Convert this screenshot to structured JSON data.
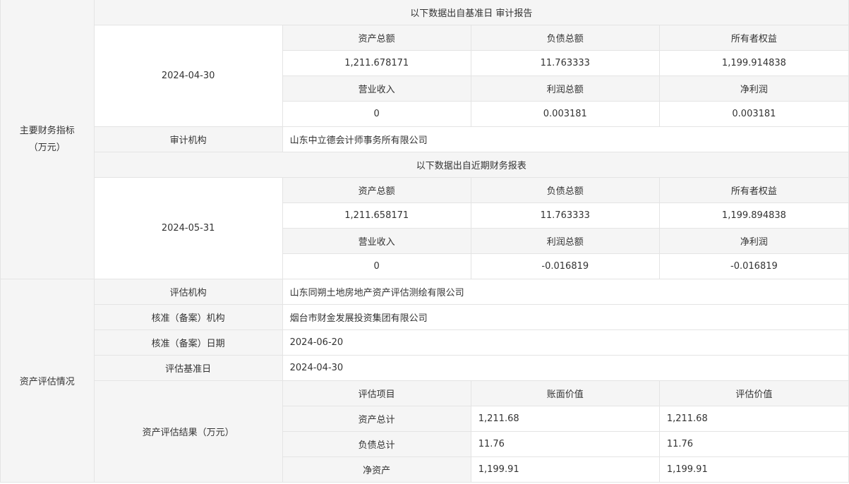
{
  "sections": {
    "financial": {
      "title_line1": "主要财务指标",
      "title_line2": "（万元）",
      "audit": {
        "source_note": "以下数据出自基准日 审计报告",
        "date": "2024-04-30",
        "headers1": [
          "资产总额",
          "负债总额",
          "所有者权益"
        ],
        "values1": [
          "1,211.678171",
          "11.763333",
          "1,199.914838"
        ],
        "headers2": [
          "营业收入",
          "利润总额",
          "净利润"
        ],
        "values2": [
          "0",
          "0.003181",
          "0.003181"
        ],
        "auditor_label": "审计机构",
        "auditor_value": "山东中立德会计师事务所有限公司"
      },
      "recent": {
        "source_note": "以下数据出自近期财务报表",
        "date": "2024-05-31",
        "headers1": [
          "资产总额",
          "负债总额",
          "所有者权益"
        ],
        "values1": [
          "1,211.658171",
          "11.763333",
          "1,199.894838"
        ],
        "headers2": [
          "营业收入",
          "利润总额",
          "净利润"
        ],
        "values2": [
          "0",
          "-0.016819",
          "-0.016819"
        ]
      }
    },
    "valuation": {
      "title": "资产评估情况",
      "rows": [
        {
          "label": "评估机构",
          "value": "山东同朔土地房地产资产评估测绘有限公司"
        },
        {
          "label": "核准（备案）机构",
          "value": "烟台市财金发展投资集团有限公司"
        },
        {
          "label": "核准（备案）日期",
          "value": "2024-06-20"
        },
        {
          "label": "评估基准日",
          "value": "2024-04-30"
        }
      ],
      "result": {
        "label": "资产评估结果（万元）",
        "headers": [
          "评估项目",
          "账面价值",
          "评估价值"
        ],
        "items": [
          {
            "name": "资产总计",
            "book": "1,211.68",
            "assessed": "1,211.68"
          },
          {
            "name": "负债总计",
            "book": "11.76",
            "assessed": "11.76"
          },
          {
            "name": "净资产",
            "book": "1,199.91",
            "assessed": "1,199.91"
          }
        ]
      }
    }
  }
}
